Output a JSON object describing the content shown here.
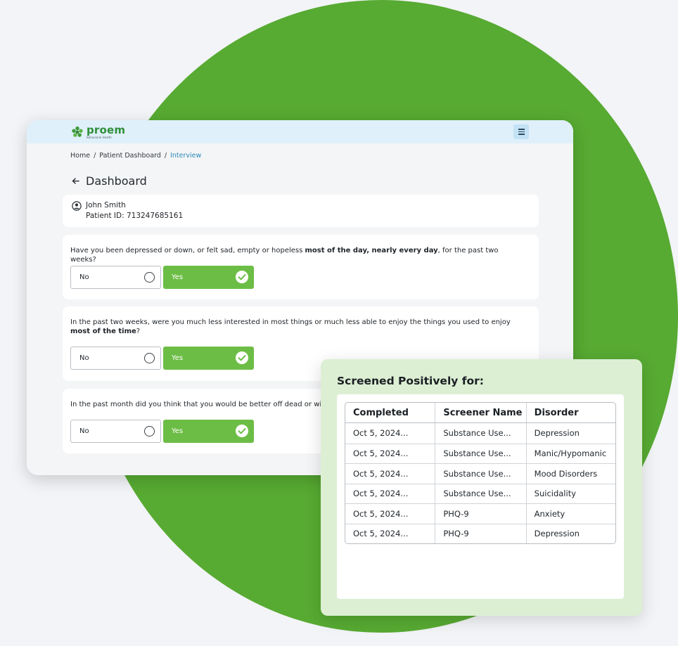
{
  "app": {
    "logo_text": "proem",
    "logo_subtitle": "Behavioral Health",
    "breadcrumb": [
      "Home",
      "Patient Dashboard",
      "Interview"
    ],
    "breadcrumb_sep": "/",
    "page_title": "Dashboard",
    "patient": {
      "name": "John Smith",
      "id_line": "Patient ID: 713247685161"
    },
    "questions": [
      {
        "text_pre": "Have you been depressed or down, or felt sad, empty or hopeless ",
        "text_bold": "most of the day, nearly every day",
        "text_post": ", for the past two weeks?",
        "no_label": "No",
        "yes_label": "Yes",
        "selected": "Yes"
      },
      {
        "text_pre": "In the past two weeks, were you much less interested in most things or much less able to enjoy the things you used to enjoy ",
        "text_bold": "most of the time",
        "text_post": "?",
        "no_label": "No",
        "yes_label": "Yes",
        "selected": "Yes"
      },
      {
        "text_pre": "In the past month did you think that you would be better off dead or wish yo",
        "text_bold": "",
        "text_post": "",
        "no_label": "No",
        "yes_label": "Yes",
        "selected": "Yes"
      }
    ]
  },
  "screened": {
    "title": "Screened Positively for:",
    "columns": [
      "Completed",
      "Screener Name",
      "Disorder"
    ],
    "rows": [
      [
        "Oct 5, 2024...",
        "Substance Use...",
        "Depression"
      ],
      [
        "Oct 5, 2024...",
        "Substance Use...",
        "Manic/Hypomanic"
      ],
      [
        "Oct 5, 2024...",
        "Substance Use...",
        "Mood Disorders"
      ],
      [
        "Oct 5, 2024...",
        "Substance Use...",
        "Suicidality"
      ],
      [
        "Oct 5, 2024...",
        "PHQ-9",
        "Anxiety"
      ],
      [
        "Oct 5, 2024...",
        "PHQ-9",
        "Depression"
      ]
    ]
  },
  "colors": {
    "brand_green": "#57aa32",
    "yes_green": "#6cbd45",
    "topbar_blue": "#dff0fa",
    "link_blue": "#2a88b8",
    "panel_green": "#dcefd3"
  }
}
